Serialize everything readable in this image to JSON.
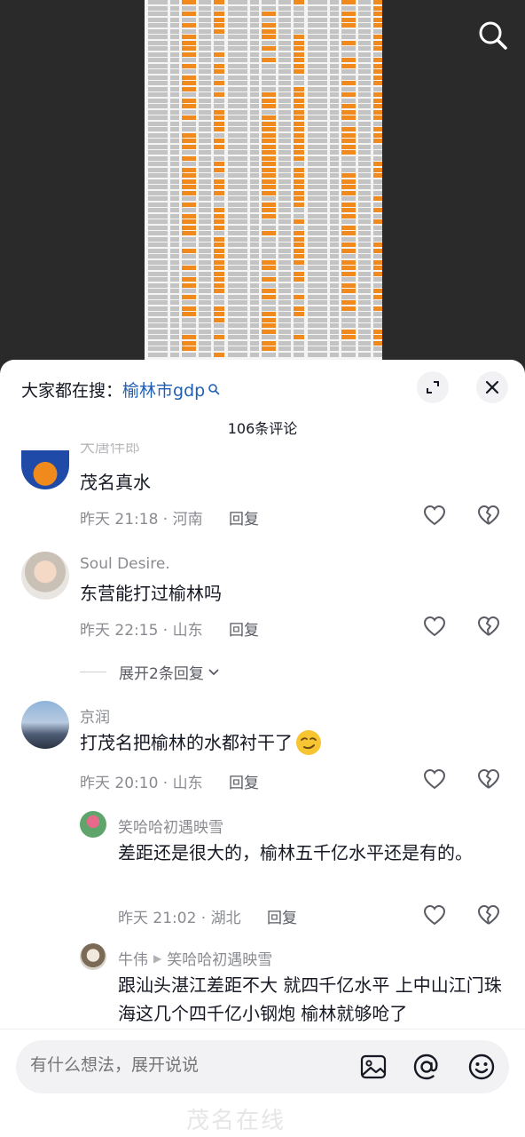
{
  "search": {
    "prefix": "大家都在搜：",
    "term": "榆林市gdp"
  },
  "comment_count": "106条评论",
  "comments": [
    {
      "name": "大唐伴郎",
      "text": "茂名真水",
      "time": "昨天 21:18 · 河南",
      "reply_label": "回复"
    },
    {
      "name": "Soul Desire.",
      "text": "东营能打过榆林吗",
      "time": "昨天 22:15 · 山东",
      "reply_label": "回复",
      "expand": "展开2条回复"
    },
    {
      "name": "京润",
      "text": "打茂名把榆林的水都衬干了",
      "time": "昨天 20:10 · 山东",
      "reply_label": "回复"
    }
  ],
  "sub_replies": [
    {
      "name": "笑哈哈初遇映雪",
      "text": "差距还是很大的，榆林五千亿水平还是有的。",
      "time": "昨天 21:02 · 湖北",
      "reply_label": "回复"
    },
    {
      "name": "牛伟",
      "reply_to": "笑哈哈初遇映雪",
      "text": "跟汕头湛江差距不大 就四千亿水平 上中山江门珠海这几个四千亿小钢炮 榆林就够呛了"
    }
  ],
  "input": {
    "placeholder": "有什么想法，展开说说"
  },
  "watermark": "茂名在线",
  "icons": {
    "search": "search-icon",
    "expand": "expand-icon",
    "close": "close-icon",
    "like": "heart-icon",
    "dislike": "broken-heart-icon",
    "image": "image-icon",
    "mention": "at-icon",
    "emoji": "emoji-icon"
  },
  "colors": {
    "accent_link": "#1f5fb5",
    "text_primary": "#161823",
    "text_secondary": "#8a8b91",
    "highlight_orange": "#f08a1c"
  }
}
